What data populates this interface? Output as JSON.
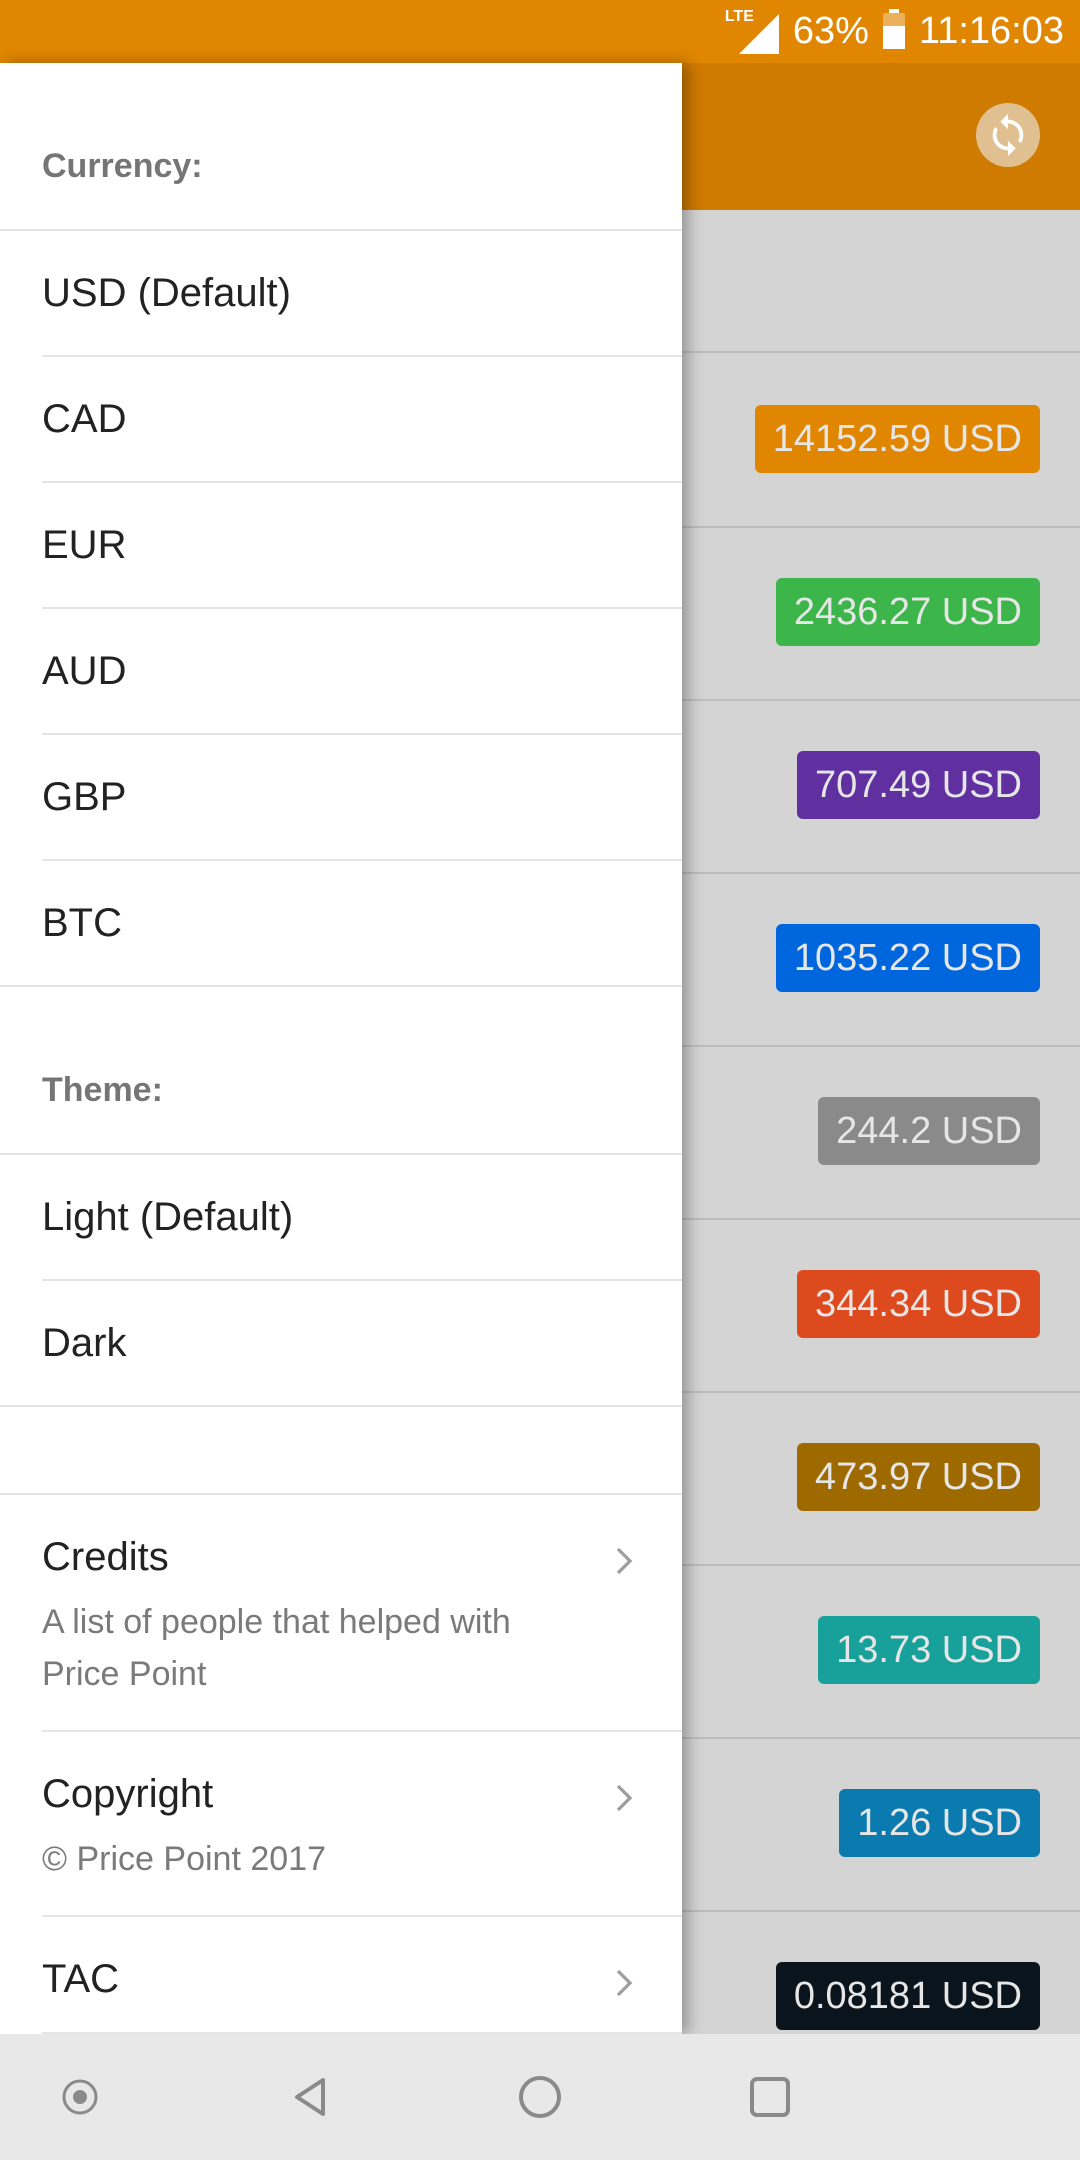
{
  "status_bar": {
    "network": "LTE",
    "battery_percent": "63%",
    "battery_level": 0.63,
    "time": "11:16:03"
  },
  "prices": [
    {
      "value": "14152.59 USD",
      "color": "#e08600"
    },
    {
      "value": "2436.27 USD",
      "color": "#3cb54a"
    },
    {
      "value": "707.49 USD",
      "color": "#6030a0"
    },
    {
      "value": "1035.22 USD",
      "color": "#0066dd"
    },
    {
      "value": "244.2 USD",
      "color": "#8a8a8a"
    },
    {
      "value": "344.34 USD",
      "color": "#dd4a1e"
    },
    {
      "value": "473.97 USD",
      "color": "#9e6a00"
    },
    {
      "value": "13.73 USD",
      "color": "#18a09a"
    },
    {
      "value": "1.26 USD",
      "color": "#0b7aae"
    },
    {
      "value": "0.08181 USD",
      "color": "#0a141c"
    }
  ],
  "drawer": {
    "currency_header": "Currency:",
    "currencies": [
      "USD (Default)",
      "CAD",
      "EUR",
      "AUD",
      "GBP",
      "BTC"
    ],
    "theme_header": "Theme:",
    "themes": [
      "Light (Default)",
      "Dark"
    ],
    "credits_title": "Credits",
    "credits_subtitle": "A list of people that helped with Price Point",
    "copyright_title": "Copyright",
    "copyright_subtitle": "© Price Point 2017",
    "tac_title": "TAC"
  },
  "icons": {
    "refresh": "refresh-icon",
    "chevron": "chevron-right-icon",
    "nav": [
      "dot-icon",
      "back-icon",
      "home-icon",
      "recents-icon"
    ]
  }
}
